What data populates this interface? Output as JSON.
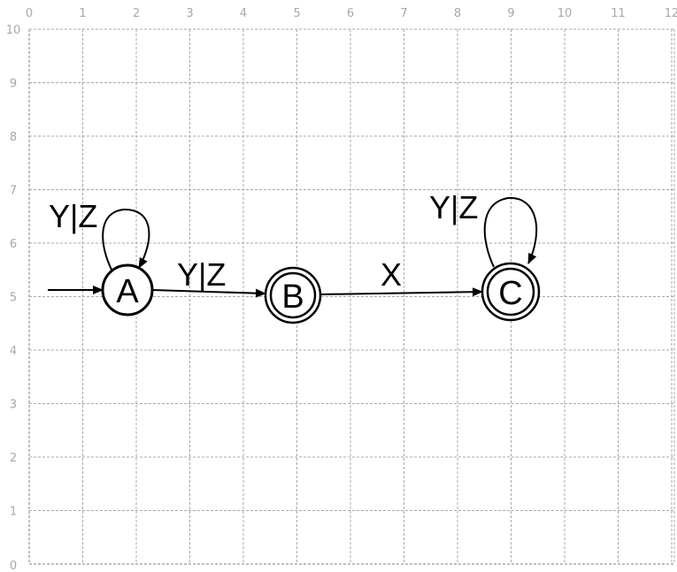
{
  "grid": {
    "x_ticks": [
      "0",
      "1",
      "2",
      "3",
      "4",
      "5",
      "6",
      "7",
      "8",
      "9",
      "10",
      "11",
      "12"
    ],
    "y_ticks": [
      "0",
      "1",
      "2",
      "3",
      "4",
      "5",
      "6",
      "7",
      "8",
      "9",
      "10"
    ],
    "color": "#a8a8a8"
  },
  "states": [
    {
      "id": "A",
      "label": "A",
      "accepting": false,
      "initial": true
    },
    {
      "id": "B",
      "label": "B",
      "accepting": true,
      "initial": false
    },
    {
      "id": "C",
      "label": "C",
      "accepting": true,
      "initial": false
    }
  ],
  "transitions": [
    {
      "from": "A",
      "to": "A",
      "label": "Y|Z"
    },
    {
      "from": "A",
      "to": "B",
      "label": "Y|Z"
    },
    {
      "from": "B",
      "to": "C",
      "label": "X"
    },
    {
      "from": "C",
      "to": "C",
      "label": "Y|Z"
    }
  ]
}
